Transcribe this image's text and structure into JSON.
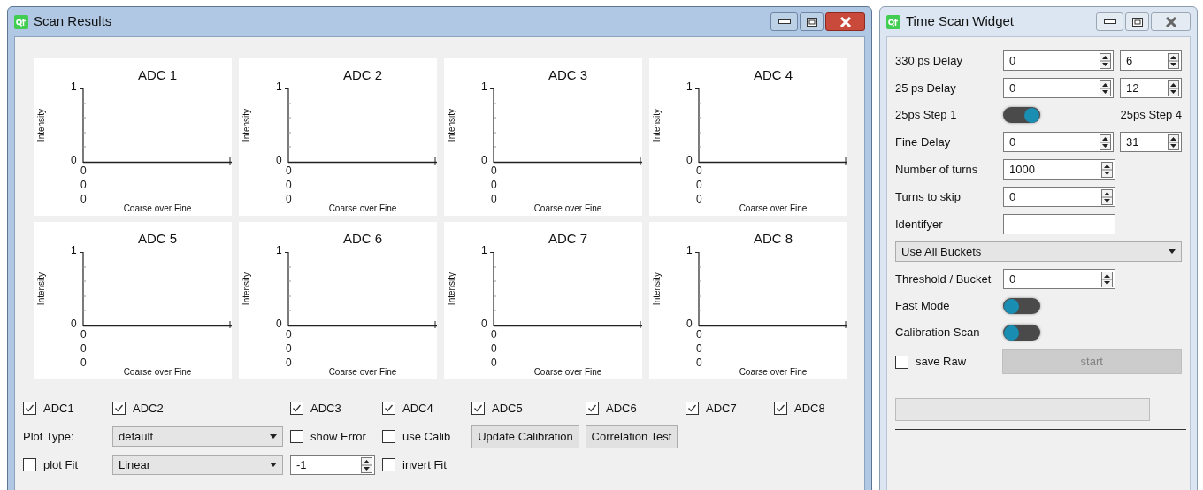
{
  "scan_window": {
    "title": "Scan Results",
    "plots": [
      {
        "title": "ADC 1",
        "ylabel": "Intensity",
        "xlabel": "Coarse over Fine",
        "yticks": [
          "1",
          "0"
        ],
        "xtick_labels": [
          "0",
          "0",
          "0"
        ]
      },
      {
        "title": "ADC 2",
        "ylabel": "Intensity",
        "xlabel": "Coarse over Fine",
        "yticks": [
          "1",
          "0"
        ],
        "xtick_labels": [
          "0",
          "0",
          "0"
        ]
      },
      {
        "title": "ADC 3",
        "ylabel": "Intensity",
        "xlabel": "Coarse over Fine",
        "yticks": [
          "1",
          "0"
        ],
        "xtick_labels": [
          "0",
          "0",
          "0"
        ]
      },
      {
        "title": "ADC 4",
        "ylabel": "Intensity",
        "xlabel": "Coarse over Fine",
        "yticks": [
          "1",
          "0"
        ],
        "xtick_labels": [
          "0",
          "0",
          "0"
        ]
      },
      {
        "title": "ADC 5",
        "ylabel": "Intensity",
        "xlabel": "Coarse over Fine",
        "yticks": [
          "1",
          "0"
        ],
        "xtick_labels": [
          "0",
          "0",
          "0"
        ]
      },
      {
        "title": "ADC 6",
        "ylabel": "Intensity",
        "xlabel": "Coarse over Fine",
        "yticks": [
          "1",
          "0"
        ],
        "xtick_labels": [
          "0",
          "0",
          "0"
        ]
      },
      {
        "title": "ADC 7",
        "ylabel": "Intensity",
        "xlabel": "Coarse over Fine",
        "yticks": [
          "1",
          "0"
        ],
        "xtick_labels": [
          "0",
          "0",
          "0"
        ]
      },
      {
        "title": "ADC 8",
        "ylabel": "Intensity",
        "xlabel": "Coarse over Fine",
        "yticks": [
          "1",
          "0"
        ],
        "xtick_labels": [
          "0",
          "0",
          "0"
        ]
      }
    ],
    "adc_checks": [
      {
        "label": "ADC1",
        "checked": true
      },
      {
        "label": "ADC2",
        "checked": true
      },
      {
        "label": "ADC3",
        "checked": true
      },
      {
        "label": "ADC4",
        "checked": true
      },
      {
        "label": "ADC5",
        "checked": true
      },
      {
        "label": "ADC6",
        "checked": true
      },
      {
        "label": "ADC7",
        "checked": true
      },
      {
        "label": "ADC8",
        "checked": true
      }
    ],
    "plot_type": {
      "label": "Plot Type:",
      "value": "default"
    },
    "show_error": {
      "label": "show Error",
      "checked": false
    },
    "use_calib": {
      "label": "use Calib",
      "checked": false
    },
    "buttons": [
      "Update Calibration",
      "Correlation Test"
    ],
    "plot_fit": {
      "label": "plot Fit",
      "checked": false
    },
    "fit_type": {
      "value": "Linear"
    },
    "fit_param": {
      "value": "-1"
    },
    "invert_fit": {
      "label": "invert Fit",
      "checked": false
    }
  },
  "time_window": {
    "title": "Time Scan Widget",
    "rows": [
      {
        "kind": "spin_pair",
        "label": "330 ps Delay",
        "values": [
          "0",
          "6"
        ]
      },
      {
        "kind": "spin_pair",
        "label": "25 ps Delay",
        "values": [
          "0",
          "12"
        ]
      },
      {
        "kind": "toggle",
        "label": "25ps Step 1",
        "on": true,
        "right_label": "25ps Step 4"
      },
      {
        "kind": "spin_pair",
        "label": "Fine Delay",
        "values": [
          "0",
          "31"
        ]
      },
      {
        "kind": "spin",
        "label": "Number of turns",
        "value": "1000"
      },
      {
        "kind": "spin",
        "label": "Turns to skip",
        "value": "0"
      },
      {
        "kind": "text",
        "label": "Identifyer"
      },
      {
        "kind": "select",
        "value": "Use All Buckets"
      },
      {
        "kind": "spin",
        "label": "Threshold / Bucket",
        "value": "0"
      },
      {
        "kind": "toggle",
        "label": "Fast Mode",
        "on": false
      },
      {
        "kind": "toggle",
        "label": "Calibration Scan",
        "on": false
      },
      {
        "kind": "check_button",
        "label": "save Raw",
        "checked": false,
        "button": "start",
        "disabled": true
      }
    ],
    "progress": {
      "level": 0
    }
  }
}
